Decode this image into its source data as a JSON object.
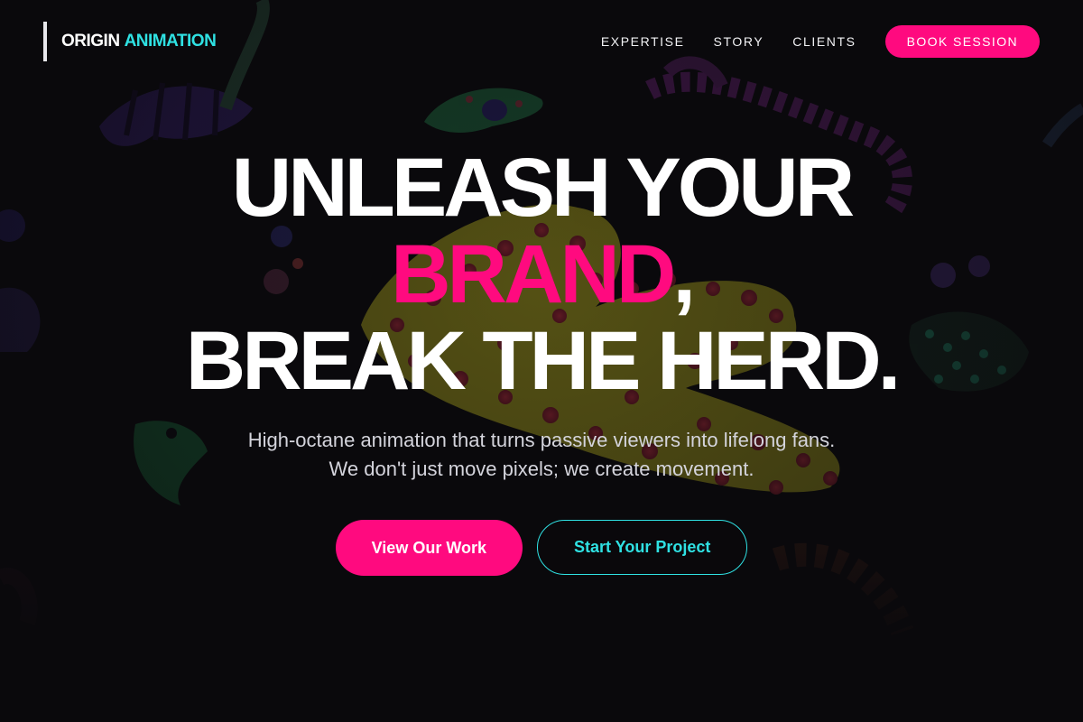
{
  "brand": {
    "name_primary": "ORIGIN",
    "name_accent": "ANIMATION"
  },
  "nav": {
    "links": [
      "EXPERTISE",
      "STORY",
      "CLIENTS"
    ],
    "cta_label": "BOOK SESSION"
  },
  "hero": {
    "headline_line1": "UNLEASH YOUR",
    "headline_brand": "BRAND",
    "headline_comma": ",",
    "headline_line3": "BREAK THE HERD.",
    "subtitle": "High-octane animation that turns passive viewers into lifelong fans. We don't just move pixels; we create movement.",
    "primary_cta": "View Our Work",
    "secondary_cta": "Start Your Project"
  },
  "colors": {
    "background": "#0a090c",
    "accent_pink": "#ff0a7f",
    "accent_cyan": "#2fe1e3",
    "text": "#ffffff"
  }
}
